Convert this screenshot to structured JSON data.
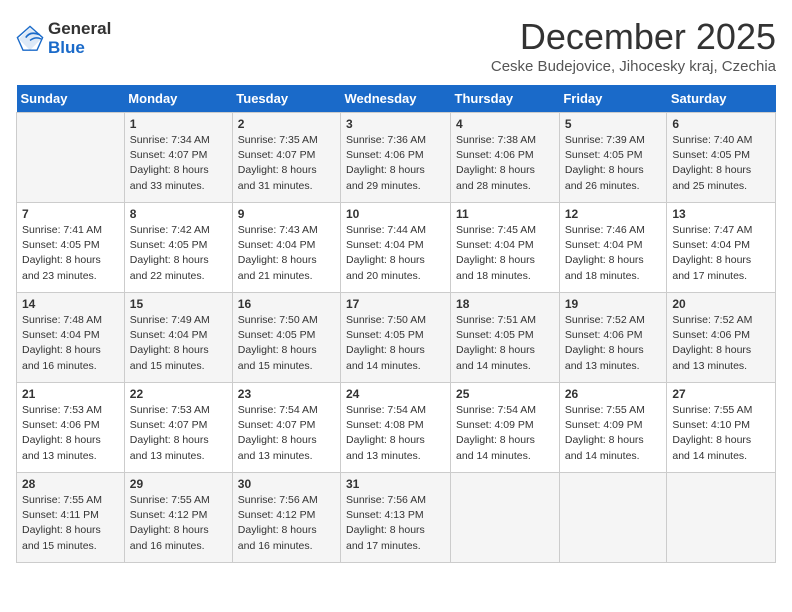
{
  "logo": {
    "general": "General",
    "blue": "Blue"
  },
  "title": "December 2025",
  "subtitle": "Ceske Budejovice, Jihocesky kraj, Czechia",
  "weekdays": [
    "Sunday",
    "Monday",
    "Tuesday",
    "Wednesday",
    "Thursday",
    "Friday",
    "Saturday"
  ],
  "weeks": [
    [
      {
        "day": "",
        "sunrise": "",
        "sunset": "",
        "daylight": ""
      },
      {
        "day": "1",
        "sunrise": "Sunrise: 7:34 AM",
        "sunset": "Sunset: 4:07 PM",
        "daylight": "Daylight: 8 hours and 33 minutes."
      },
      {
        "day": "2",
        "sunrise": "Sunrise: 7:35 AM",
        "sunset": "Sunset: 4:07 PM",
        "daylight": "Daylight: 8 hours and 31 minutes."
      },
      {
        "day": "3",
        "sunrise": "Sunrise: 7:36 AM",
        "sunset": "Sunset: 4:06 PM",
        "daylight": "Daylight: 8 hours and 29 minutes."
      },
      {
        "day": "4",
        "sunrise": "Sunrise: 7:38 AM",
        "sunset": "Sunset: 4:06 PM",
        "daylight": "Daylight: 8 hours and 28 minutes."
      },
      {
        "day": "5",
        "sunrise": "Sunrise: 7:39 AM",
        "sunset": "Sunset: 4:05 PM",
        "daylight": "Daylight: 8 hours and 26 minutes."
      },
      {
        "day": "6",
        "sunrise": "Sunrise: 7:40 AM",
        "sunset": "Sunset: 4:05 PM",
        "daylight": "Daylight: 8 hours and 25 minutes."
      }
    ],
    [
      {
        "day": "7",
        "sunrise": "Sunrise: 7:41 AM",
        "sunset": "Sunset: 4:05 PM",
        "daylight": "Daylight: 8 hours and 23 minutes."
      },
      {
        "day": "8",
        "sunrise": "Sunrise: 7:42 AM",
        "sunset": "Sunset: 4:05 PM",
        "daylight": "Daylight: 8 hours and 22 minutes."
      },
      {
        "day": "9",
        "sunrise": "Sunrise: 7:43 AM",
        "sunset": "Sunset: 4:04 PM",
        "daylight": "Daylight: 8 hours and 21 minutes."
      },
      {
        "day": "10",
        "sunrise": "Sunrise: 7:44 AM",
        "sunset": "Sunset: 4:04 PM",
        "daylight": "Daylight: 8 hours and 20 minutes."
      },
      {
        "day": "11",
        "sunrise": "Sunrise: 7:45 AM",
        "sunset": "Sunset: 4:04 PM",
        "daylight": "Daylight: 8 hours and 18 minutes."
      },
      {
        "day": "12",
        "sunrise": "Sunrise: 7:46 AM",
        "sunset": "Sunset: 4:04 PM",
        "daylight": "Daylight: 8 hours and 18 minutes."
      },
      {
        "day": "13",
        "sunrise": "Sunrise: 7:47 AM",
        "sunset": "Sunset: 4:04 PM",
        "daylight": "Daylight: 8 hours and 17 minutes."
      }
    ],
    [
      {
        "day": "14",
        "sunrise": "Sunrise: 7:48 AM",
        "sunset": "Sunset: 4:04 PM",
        "daylight": "Daylight: 8 hours and 16 minutes."
      },
      {
        "day": "15",
        "sunrise": "Sunrise: 7:49 AM",
        "sunset": "Sunset: 4:04 PM",
        "daylight": "Daylight: 8 hours and 15 minutes."
      },
      {
        "day": "16",
        "sunrise": "Sunrise: 7:50 AM",
        "sunset": "Sunset: 4:05 PM",
        "daylight": "Daylight: 8 hours and 15 minutes."
      },
      {
        "day": "17",
        "sunrise": "Sunrise: 7:50 AM",
        "sunset": "Sunset: 4:05 PM",
        "daylight": "Daylight: 8 hours and 14 minutes."
      },
      {
        "day": "18",
        "sunrise": "Sunrise: 7:51 AM",
        "sunset": "Sunset: 4:05 PM",
        "daylight": "Daylight: 8 hours and 14 minutes."
      },
      {
        "day": "19",
        "sunrise": "Sunrise: 7:52 AM",
        "sunset": "Sunset: 4:06 PM",
        "daylight": "Daylight: 8 hours and 13 minutes."
      },
      {
        "day": "20",
        "sunrise": "Sunrise: 7:52 AM",
        "sunset": "Sunset: 4:06 PM",
        "daylight": "Daylight: 8 hours and 13 minutes."
      }
    ],
    [
      {
        "day": "21",
        "sunrise": "Sunrise: 7:53 AM",
        "sunset": "Sunset: 4:06 PM",
        "daylight": "Daylight: 8 hours and 13 minutes."
      },
      {
        "day": "22",
        "sunrise": "Sunrise: 7:53 AM",
        "sunset": "Sunset: 4:07 PM",
        "daylight": "Daylight: 8 hours and 13 minutes."
      },
      {
        "day": "23",
        "sunrise": "Sunrise: 7:54 AM",
        "sunset": "Sunset: 4:07 PM",
        "daylight": "Daylight: 8 hours and 13 minutes."
      },
      {
        "day": "24",
        "sunrise": "Sunrise: 7:54 AM",
        "sunset": "Sunset: 4:08 PM",
        "daylight": "Daylight: 8 hours and 13 minutes."
      },
      {
        "day": "25",
        "sunrise": "Sunrise: 7:54 AM",
        "sunset": "Sunset: 4:09 PM",
        "daylight": "Daylight: 8 hours and 14 minutes."
      },
      {
        "day": "26",
        "sunrise": "Sunrise: 7:55 AM",
        "sunset": "Sunset: 4:09 PM",
        "daylight": "Daylight: 8 hours and 14 minutes."
      },
      {
        "day": "27",
        "sunrise": "Sunrise: 7:55 AM",
        "sunset": "Sunset: 4:10 PM",
        "daylight": "Daylight: 8 hours and 14 minutes."
      }
    ],
    [
      {
        "day": "28",
        "sunrise": "Sunrise: 7:55 AM",
        "sunset": "Sunset: 4:11 PM",
        "daylight": "Daylight: 8 hours and 15 minutes."
      },
      {
        "day": "29",
        "sunrise": "Sunrise: 7:55 AM",
        "sunset": "Sunset: 4:12 PM",
        "daylight": "Daylight: 8 hours and 16 minutes."
      },
      {
        "day": "30",
        "sunrise": "Sunrise: 7:56 AM",
        "sunset": "Sunset: 4:12 PM",
        "daylight": "Daylight: 8 hours and 16 minutes."
      },
      {
        "day": "31",
        "sunrise": "Sunrise: 7:56 AM",
        "sunset": "Sunset: 4:13 PM",
        "daylight": "Daylight: 8 hours and 17 minutes."
      },
      {
        "day": "",
        "sunrise": "",
        "sunset": "",
        "daylight": ""
      },
      {
        "day": "",
        "sunrise": "",
        "sunset": "",
        "daylight": ""
      },
      {
        "day": "",
        "sunrise": "",
        "sunset": "",
        "daylight": ""
      }
    ]
  ]
}
